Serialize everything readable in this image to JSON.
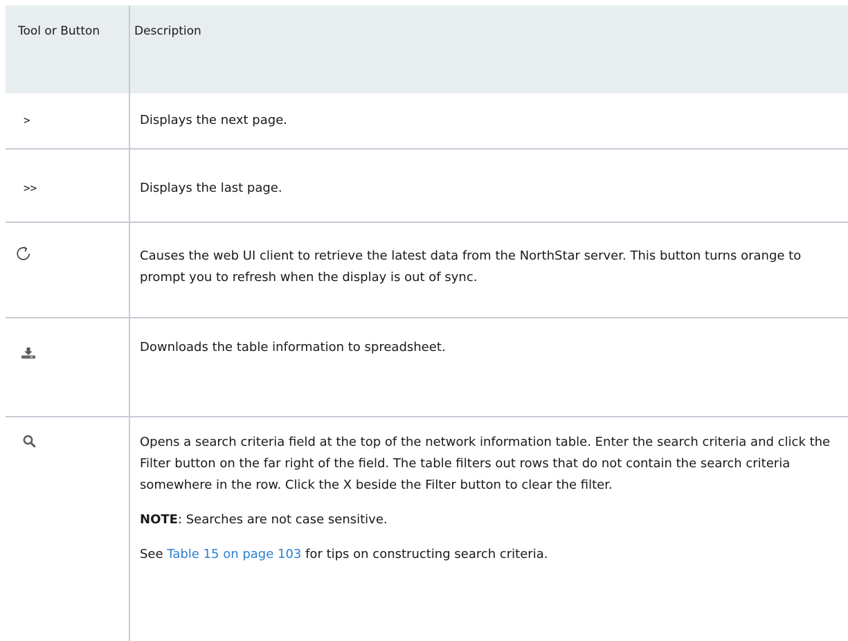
{
  "header": {
    "col1": "Tool or Button",
    "col2": "Description"
  },
  "rows": [
    {
      "tool": ">",
      "description": "Displays the next page."
    },
    {
      "tool": ">>",
      "description": "Displays the last page."
    },
    {
      "tool_icon": "refresh-icon",
      "description": "Causes the web UI client to retrieve the latest data from the NorthStar server. This button turns orange to prompt you to refresh when the display is out of sync."
    },
    {
      "tool_icon": "download-icon",
      "description": "Downloads the table information to spreadsheet."
    },
    {
      "tool_icon": "search-icon",
      "description": "Opens a search criteria field at the top of the network information table. Enter the search criteria and click the Filter button on the far right of the field. The table filters out rows that do not contain the search criteria somewhere in the row. Click the X beside the Filter button to clear the filter.",
      "note_label": "NOTE",
      "note_text": ": Searches are not case sensitive.",
      "see_prefix": "See ",
      "see_link": "Table 15 on page 103",
      "see_suffix": " for tips on constructing search criteria."
    }
  ],
  "colors": {
    "header_bg": "#e8edf0",
    "divider": "#c4cbd3",
    "link": "#2d7fd1"
  }
}
